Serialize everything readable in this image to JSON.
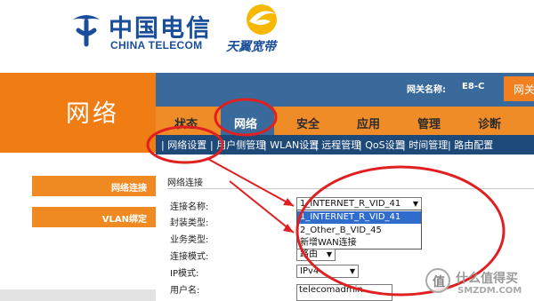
{
  "brand": {
    "ct_cn": "中国电信",
    "ct_en": "CHINA TELECOM",
    "tianyi": "天翼宽带",
    "accent": "#ef7d14",
    "blue": "#3a6a9c"
  },
  "page_title": "网络",
  "gateway": {
    "label": "网关名称:",
    "value": "E8-C",
    "right_tab": "网关"
  },
  "nav": {
    "items": [
      {
        "label": "状态"
      },
      {
        "label": "网络"
      },
      {
        "label": "安全"
      },
      {
        "label": "应用"
      },
      {
        "label": "管理"
      },
      {
        "label": "诊断"
      }
    ],
    "active": "网络"
  },
  "subnav": {
    "items": [
      {
        "label": "| 网络设置"
      },
      {
        "label": "| 用户侧管理"
      },
      {
        "label": "| WLAN设置"
      },
      {
        "label": "| 远程管理"
      },
      {
        "label": "| QoS设置"
      },
      {
        "label": "| 时间管理"
      },
      {
        "label": "| 路由配置"
      }
    ]
  },
  "sidebar": {
    "items": [
      {
        "label": "网络连接"
      },
      {
        "label": "VLAN绑定"
      }
    ]
  },
  "content": {
    "title": "网络连接",
    "fields": {
      "conn_name": "连接名称:",
      "encap": "封装类型:",
      "service": "业务类型:",
      "mode": "连接模式:",
      "ip_mode": "IP模式:",
      "username": "用户名:"
    },
    "conn_select_value": "1_INTERNET_R_VID_41",
    "dropdown_options": [
      "1_INTERNET_R_VID_41",
      "2_Other_B_VID_45",
      "新增WAN连接"
    ],
    "dropdown_selected": "1_INTERNET_R_VID_41",
    "mode_value": "路由",
    "ip_mode_value": "IPv4",
    "username_value": "telecomadmin"
  },
  "watermark": {
    "badge": "值",
    "cn": "什么值得买",
    "en": "SMZDM.COM"
  }
}
